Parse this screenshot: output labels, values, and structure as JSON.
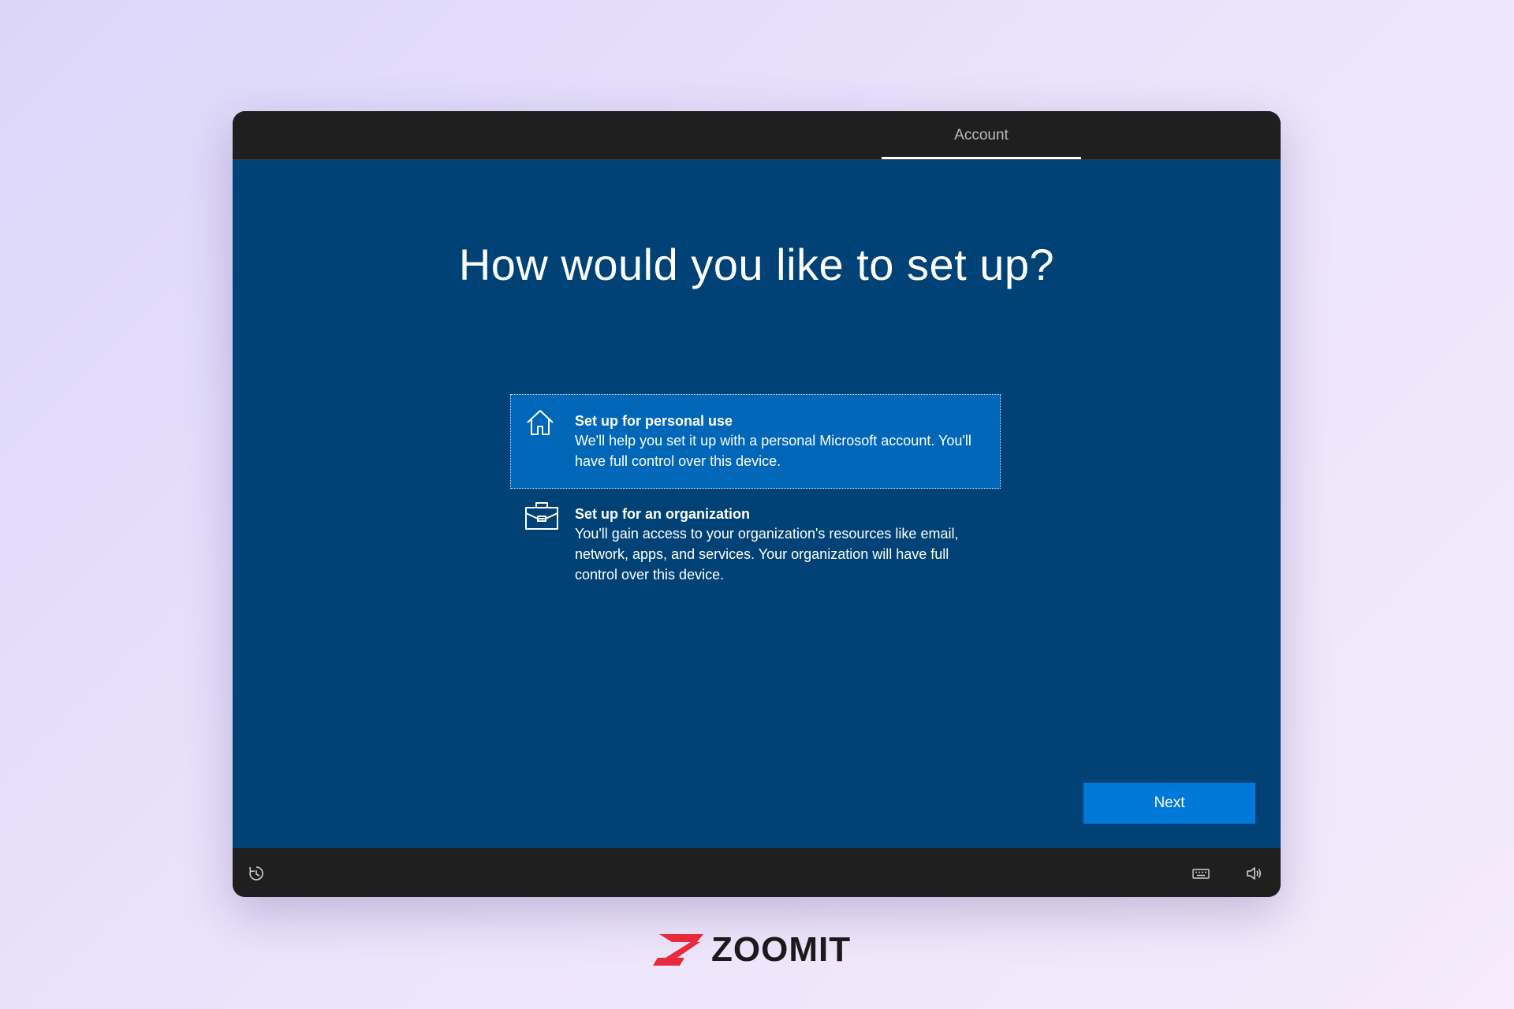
{
  "header": {
    "tab_label": "Account"
  },
  "main": {
    "heading": "How would you like to set up?",
    "options": [
      {
        "title": "Set up for personal use",
        "description": "We'll help you set it up with a personal Microsoft account. You'll have full control over this device.",
        "icon": "home-icon",
        "selected": true
      },
      {
        "title": "Set up for an organization",
        "description": "You'll gain access to your organization's resources like email, network, apps, and services. Your organization will have full control over this device.",
        "icon": "briefcase-icon",
        "selected": false
      }
    ],
    "next_label": "Next"
  },
  "footer": {
    "icons": [
      "ease-of-access-icon",
      "keyboard-icon",
      "volume-icon"
    ]
  },
  "brand": {
    "logo_text": "ZOOMIT",
    "logo_color": "#e62b3c"
  },
  "colors": {
    "background_main": "#004275",
    "selected_option": "#0067b8",
    "button": "#0078d7",
    "chrome": "#1f1f1f"
  }
}
